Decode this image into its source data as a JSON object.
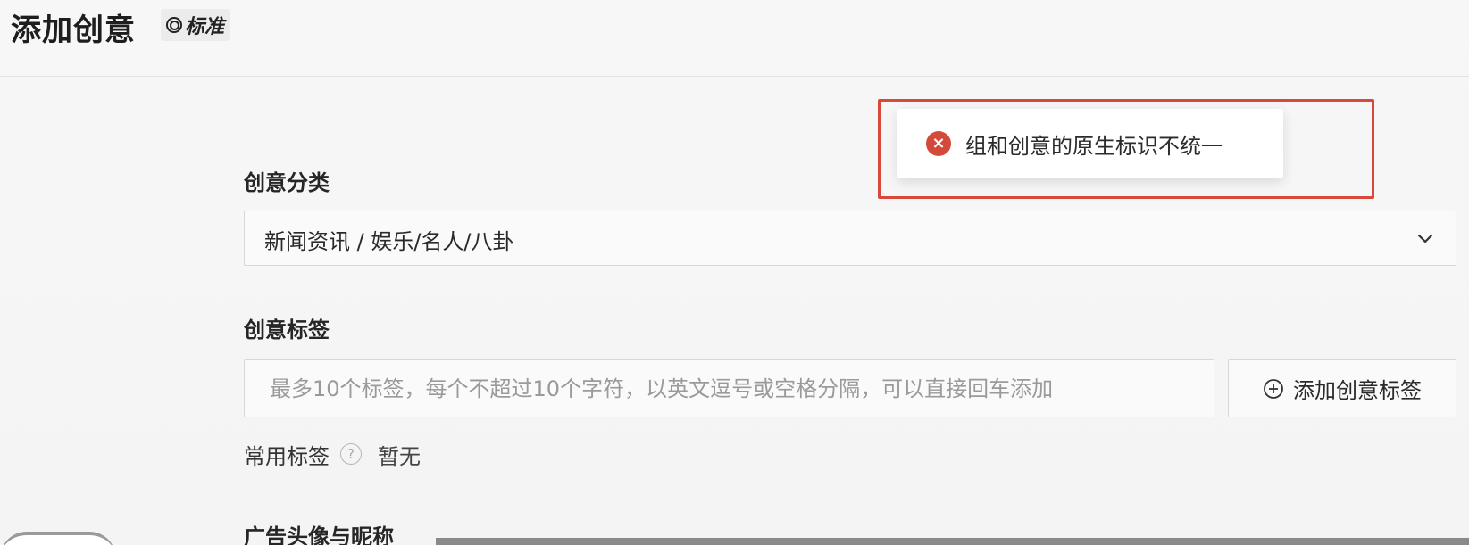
{
  "header": {
    "title": "添加创意",
    "mode_badge": "标准"
  },
  "category": {
    "label": "创意分类",
    "value": "新闻资讯 / 娱乐/名人/八卦"
  },
  "tags": {
    "label": "创意标签",
    "placeholder": "最多10个标签，每个不超过10个字符，以英文逗号或空格分隔，可以直接回车添加",
    "add_button": "添加创意标签",
    "common_label": "常用标签",
    "common_value": "暂无"
  },
  "avatar_section": {
    "label": "广告头像与昵称"
  },
  "toast": {
    "message": "组和创意的原生标识不统一",
    "type": "error"
  },
  "icons": {
    "mode": "target-icon",
    "dropdown": "chevron-down-icon",
    "add": "plus-circle-icon",
    "help": "question-circle-icon",
    "error": "close-circle-icon"
  },
  "colors": {
    "error": "#d44a3a",
    "highlight_border": "#d9483b"
  }
}
